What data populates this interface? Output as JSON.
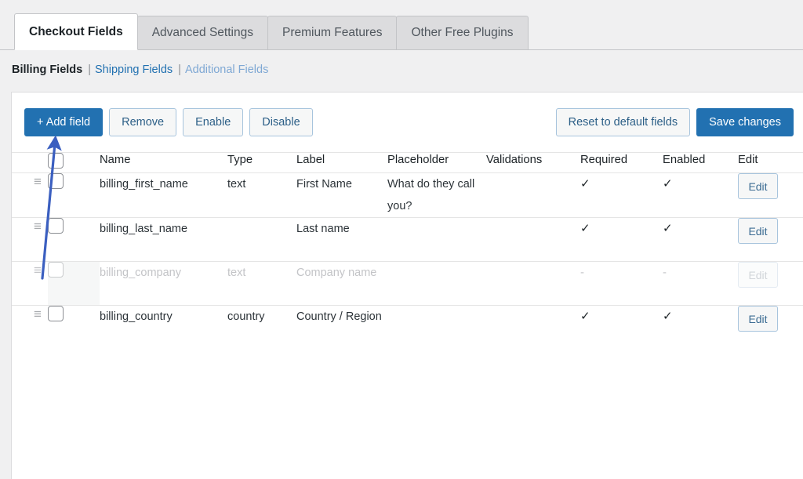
{
  "tabs": [
    {
      "label": "Checkout Fields",
      "active": true
    },
    {
      "label": "Advanced Settings",
      "active": false
    },
    {
      "label": "Premium Features",
      "active": false
    },
    {
      "label": "Other Free Plugins",
      "active": false
    }
  ],
  "subnav": {
    "active": "Billing Fields",
    "sep1": "|",
    "link1": "Shipping Fields",
    "sep2": "|",
    "link2": "Additional Fields"
  },
  "toolbar": {
    "add_field": "+ Add field",
    "remove": "Remove",
    "enable": "Enable",
    "disable": "Disable",
    "reset": "Reset to default fields",
    "save": "Save changes"
  },
  "table": {
    "headers": {
      "name": "Name",
      "type": "Type",
      "label": "Label",
      "placeholder": "Placeholder",
      "validations": "Validations",
      "required": "Required",
      "enabled": "Enabled",
      "edit": "Edit"
    },
    "edit_label": "Edit",
    "tick": "✓",
    "dash": "-",
    "handle_glyph": "≡",
    "rows": [
      {
        "name": "billing_first_name",
        "type": "text",
        "label": "First Name",
        "placeholder": "What do they call you?",
        "validations": "",
        "required": "✓",
        "enabled": "✓",
        "edit": "Edit",
        "disabled": false
      },
      {
        "name": "billing_last_name",
        "type": "",
        "label": "Last name",
        "placeholder": "",
        "validations": "",
        "required": "✓",
        "enabled": "✓",
        "edit": "Edit",
        "disabled": false
      },
      {
        "name": "billing_company",
        "type": "text",
        "label": "Company name",
        "placeholder": "",
        "validations": "",
        "required": "-",
        "enabled": "-",
        "edit": "Edit",
        "disabled": true
      },
      {
        "name": "billing_country",
        "type": "country",
        "label": "Country / Region",
        "placeholder": "",
        "validations": "",
        "required": "✓",
        "enabled": "✓",
        "edit": "Edit",
        "disabled": false
      }
    ]
  },
  "annotation": {
    "arrow_color": "#3b5fc0",
    "points_to": "+ Add field"
  },
  "colors": {
    "primary": "#2271b1",
    "link": "#2271b1",
    "page_bg": "#f0f0f1",
    "card_bg": "#ffffff",
    "border": "#dcdcde"
  }
}
